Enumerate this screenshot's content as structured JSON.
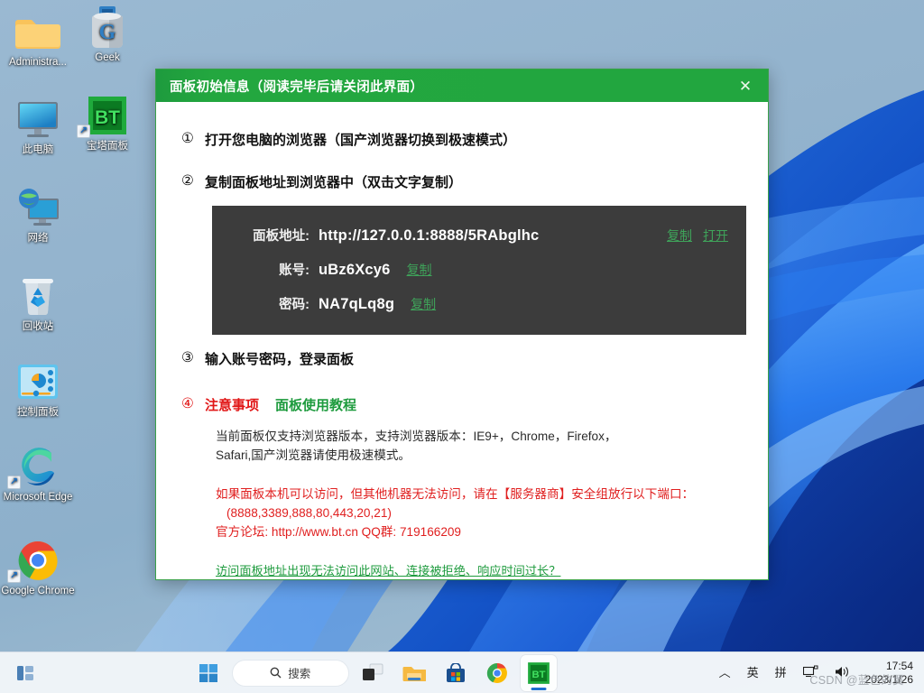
{
  "desktop": {
    "icons": [
      {
        "name": "administrator-folder",
        "label": "Administra...",
        "icon": "folder-icon",
        "shortcut": false
      },
      {
        "name": "geek-uninstaller",
        "label": "Geek",
        "icon": "geek-trash-icon",
        "shortcut": false
      },
      {
        "name": "this-pc",
        "label": "此电脑",
        "icon": "monitor-icon",
        "shortcut": false
      },
      {
        "name": "bt-panel",
        "label": "宝塔面板",
        "icon": "bt-icon",
        "shortcut": true
      },
      {
        "name": "network",
        "label": "网络",
        "icon": "network-icon",
        "shortcut": false
      },
      {
        "name": "recycle-bin",
        "label": "回收站",
        "icon": "recycle-bin-icon",
        "shortcut": false
      },
      {
        "name": "control-panel",
        "label": "控制面板",
        "icon": "control-panel-icon",
        "shortcut": false
      },
      {
        "name": "microsoft-edge",
        "label": "Microsoft Edge",
        "icon": "edge-icon",
        "shortcut": true
      },
      {
        "name": "google-chrome",
        "label": "Google Chrome",
        "icon": "chrome-icon",
        "shortcut": true
      }
    ]
  },
  "dialog": {
    "title": "面板初始信息（阅读完毕后请关闭此界面）",
    "close_label": "✕",
    "accent_green": "#22a73f",
    "steps": {
      "one": {
        "num": "①",
        "text": "打开您电脑的浏览器（国产浏览器切换到极速模式）"
      },
      "two": {
        "num": "②",
        "text": "复制面板地址到浏览器中（双击文字复制）"
      },
      "three": {
        "num": "③",
        "text": "输入账号密码，登录面板"
      },
      "four": {
        "num": "④",
        "text": "注意事项",
        "tutorial_link": "面板使用教程"
      }
    },
    "credentials": {
      "panel_bg": "#3c3c3c",
      "address_label": "面板地址:",
      "address_value": "http://127.0.0.1:8888/5RAbglhc",
      "address_copy": "复制",
      "address_open": "打开",
      "username_label": "账号:",
      "username_value": "uBz6Xcy6",
      "username_copy": "复制",
      "password_label": "密码:",
      "password_value": "NA7qLq8g",
      "password_copy": "复制"
    },
    "browser_note_line1": "当前面板仅支持浏览器版本，支持浏览器版本：IE9+，Chrome，Firefox，",
    "browser_note_line2": "Safari,国产浏览器请使用极速模式。",
    "warning_line1": "如果面板本机可以访问，但其他机器无法访问，请在【服务器商】安全组放行以下端口：",
    "warning_line2": "(8888,3389,888,80,443,20,21)",
    "warning_line3": "官方论坛: http://www.bt.cn  QQ群: 719166209",
    "help_link": "访问面板地址出现无法访问此网站、连接被拒绝、响应时间过长？"
  },
  "taskbar": {
    "start": "start-icon",
    "search_placeholder": "搜索",
    "items": [
      {
        "name": "task-view",
        "icon": "task-view-icon",
        "active": false
      },
      {
        "name": "file-explorer",
        "icon": "folder-icon",
        "active": false
      },
      {
        "name": "microsoft-store",
        "icon": "store-icon",
        "active": false
      },
      {
        "name": "chrome",
        "icon": "chrome-icon",
        "active": false
      },
      {
        "name": "bt-panel",
        "icon": "bt-icon",
        "active": true
      }
    ],
    "tray": {
      "chevron": "︿",
      "ime_lang": "英",
      "ime_mode": "拼",
      "network": "network-icon",
      "volume": "volume-icon",
      "time": "17:54",
      "date": "2023/1/26"
    },
    "watermark": "CSDN @蓝色的翼"
  }
}
